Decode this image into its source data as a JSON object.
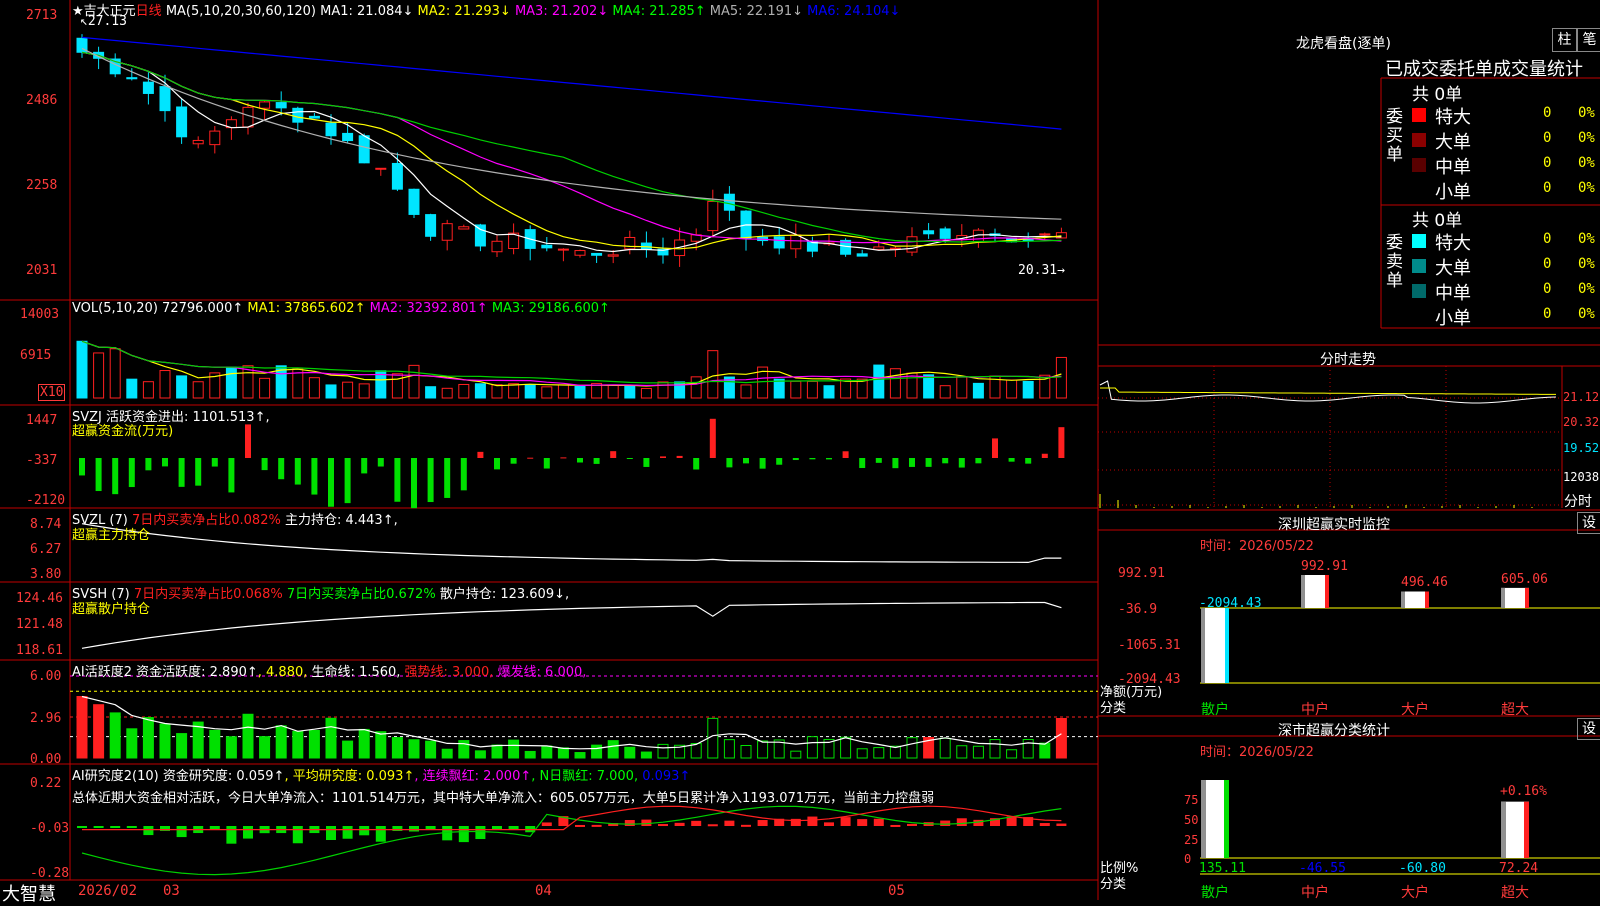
{
  "colors": {
    "up": "#ff2020",
    "down": "#00e5ff",
    "green": "#00d000",
    "white": "#ffffff",
    "yellow": "#ffff00",
    "magenta": "#ff00ff",
    "lime": "#00ff00",
    "gray": "#b0b0b0",
    "blue": "#0000ff",
    "grid": "#c00000",
    "axis": "#ff3b3b"
  },
  "main_chart": {
    "title_line": [
      {
        "text": "★",
        "color": "#ffffff"
      },
      {
        "text": "吉大正元",
        "color": "#ffffff"
      },
      {
        "text": "日线",
        "color": "#ff2020"
      },
      {
        "text": " MA(5,10,20,30,60,120) ",
        "color": "#ffffff"
      },
      {
        "text": "MA1: 21.084↓",
        "color": "#ffffff"
      },
      {
        "text": " MA2: 21.293↓",
        "color": "#ffff00"
      },
      {
        "text": " MA3: 21.202↓",
        "color": "#ff00ff"
      },
      {
        "text": " MA4: 21.285↑",
        "color": "#00ff00"
      },
      {
        "text": " MA5: 22.191↓",
        "color": "#b0b0b0"
      },
      {
        "text": " MA6: 24.104↓",
        "color": "#0000ff"
      }
    ],
    "y_labels": [
      "2713",
      "2486",
      "2258",
      "2031"
    ],
    "high_label": "27.13",
    "low_label": "20.31",
    "x_labels": [
      "2026/02",
      "03",
      "04",
      "05"
    ]
  },
  "vol_chart": {
    "title_line": [
      {
        "text": "VOL(5,10,20) ",
        "color": "#ffffff"
      },
      {
        "text": "72796.000↑",
        "color": "#ffffff"
      },
      {
        "text": " MA1: 37865.602↑",
        "color": "#ffff00"
      },
      {
        "text": " MA2: 32392.801↑",
        "color": "#ff00ff"
      },
      {
        "text": " MA3: 29186.600↑",
        "color": "#00ff00"
      }
    ],
    "y_labels": [
      "14003",
      "6915"
    ],
    "unit": "X10"
  },
  "svzj": {
    "title_line": [
      {
        "text": "SVZJ  ",
        "color": "#ffffff"
      },
      {
        "text": "活跃资金进出: 1101.513↑",
        "color": "#ffffff"
      },
      {
        "text": ",",
        "color": "#ffffff"
      }
    ],
    "sub": "超赢资金流(万元)",
    "y_labels": [
      "1447",
      "-337",
      "-2120"
    ]
  },
  "svzl": {
    "title_line": [
      {
        "text": "SVZL (7) ",
        "color": "#ffffff"
      },
      {
        "text": "7日内买卖净占比0.082%",
        "color": "#ff2020"
      },
      {
        "text": " 主力持仓: 4.443↑",
        "color": "#ffffff"
      },
      {
        "text": ",",
        "color": "#ffffff"
      }
    ],
    "sub": "超赢主力持仓",
    "y_labels": [
      "8.74",
      "6.27",
      "3.80"
    ]
  },
  "svsh": {
    "title_line": [
      {
        "text": "SVSH (7) ",
        "color": "#ffffff"
      },
      {
        "text": "7日内买卖净占比0.068%",
        "color": "#ff2020"
      },
      {
        "text": " 7日内买卖净占比0.672%",
        "color": "#00ff00"
      },
      {
        "text": " 散户持仓: 123.609↓",
        "color": "#ffffff"
      },
      {
        "text": ",",
        "color": "#ffffff"
      }
    ],
    "sub": "超赢散户持仓",
    "y_labels": [
      "124.46",
      "121.48",
      "118.61"
    ]
  },
  "ai_active": {
    "title_line": [
      {
        "text": "AI活跃度2 ",
        "color": "#ffffff"
      },
      {
        "text": "资金活跃度: 2.890↑",
        "color": "#ffffff"
      },
      {
        "text": ", 4.880,",
        "color": "#ffff00"
      },
      {
        "text": " 生命线: 1.560,",
        "color": "#ffffff"
      },
      {
        "text": " 强势线: 3.000,",
        "color": "#ff2020"
      },
      {
        "text": " 爆发线: 6.000,",
        "color": "#ff00ff"
      }
    ],
    "y_labels": [
      "6.00",
      "2.96",
      "0.00"
    ]
  },
  "ai_research": {
    "title_line": [
      {
        "text": "AI研究度2(10) ",
        "color": "#ffffff"
      },
      {
        "text": "资金研究度: 0.059↑",
        "color": "#ffffff"
      },
      {
        "text": ", 平均研究度: 0.093↑",
        "color": "#ffff00"
      },
      {
        "text": ", 连续飘红: 2.000↑",
        "color": "#ff00ff"
      },
      {
        "text": ", N日飘红: 7.000,",
        "color": "#00ff00"
      },
      {
        "text": " 0.093↑",
        "color": "#0000ff"
      }
    ],
    "summary": "总体近期大资金相对活跃，今日大单净流入：1101.514万元，其中特大单净流入：605.057万元，大单5日累计净入1193.071万元，当前主力控盘弱",
    "y_labels": [
      "0.22",
      "-0.03",
      "-0.28"
    ]
  },
  "footer": {
    "brand": "大智慧"
  },
  "right_panel": {
    "dragon": {
      "title": "龙虎看盘(逐单)",
      "tabs": [
        "柱",
        "笔"
      ],
      "header": "已成交委托单成交量统计",
      "buy": {
        "side": "委买单",
        "total": "共 0单",
        "rows": [
          {
            "label": "特大",
            "count": "0",
            "pct": "0%",
            "color": "#ff0000"
          },
          {
            "label": "大单",
            "count": "0",
            "pct": "0%",
            "color": "#8b0000"
          },
          {
            "label": "中单",
            "count": "0",
            "pct": "0%",
            "color": "#5a0000"
          },
          {
            "label": "小单",
            "count": "0",
            "pct": "0%",
            "color": "#000000"
          }
        ]
      },
      "sell": {
        "side": "委卖单",
        "total": "共 0单",
        "rows": [
          {
            "label": "特大",
            "count": "0",
            "pct": "0%",
            "color": "#00ffff"
          },
          {
            "label": "大单",
            "count": "0",
            "pct": "0%",
            "color": "#008b8b"
          },
          {
            "label": "中单",
            "count": "0",
            "pct": "0%",
            "color": "#006a6a"
          },
          {
            "label": "小单",
            "count": "0",
            "pct": "0%",
            "color": "#000000"
          }
        ]
      }
    },
    "intraday": {
      "title": "分时走势",
      "y_labels": [
        "21.12",
        "20.32",
        "19.52",
        "12038"
      ],
      "bottom": "分时"
    },
    "sz_monitor": {
      "title": "深圳超赢实时监控",
      "settings": "设",
      "time": "时间：2026/05/22",
      "y_labels": [
        "992.91",
        "-36.9",
        "-1065.31",
        "-2094.43"
      ],
      "y_caption": "净额(万元)",
      "x_caption": "分类",
      "categories": [
        "散户",
        "中户",
        "大户",
        "超大"
      ],
      "values": [
        -2094.43,
        992.91,
        496.46,
        605.06
      ],
      "value_labels": [
        "-2094.43",
        "992.91",
        "496.46",
        "605.06"
      ]
    },
    "sz_class": {
      "title": "深市超赢分类统计",
      "settings": "设",
      "time": "时间：2026/05/22",
      "y_labels": [
        "75",
        "50",
        "25",
        "0"
      ],
      "y_caption": "比例%",
      "x_caption": "分类",
      "categories": [
        "散户",
        "中户",
        "大户",
        "超大"
      ],
      "values": [
        135.11,
        -46.55,
        -60.8,
        72.24
      ],
      "value_labels": [
        "135.11",
        "-46.55",
        "-60.80",
        "72.24"
      ],
      "top_note": "+0.16%"
    }
  }
}
